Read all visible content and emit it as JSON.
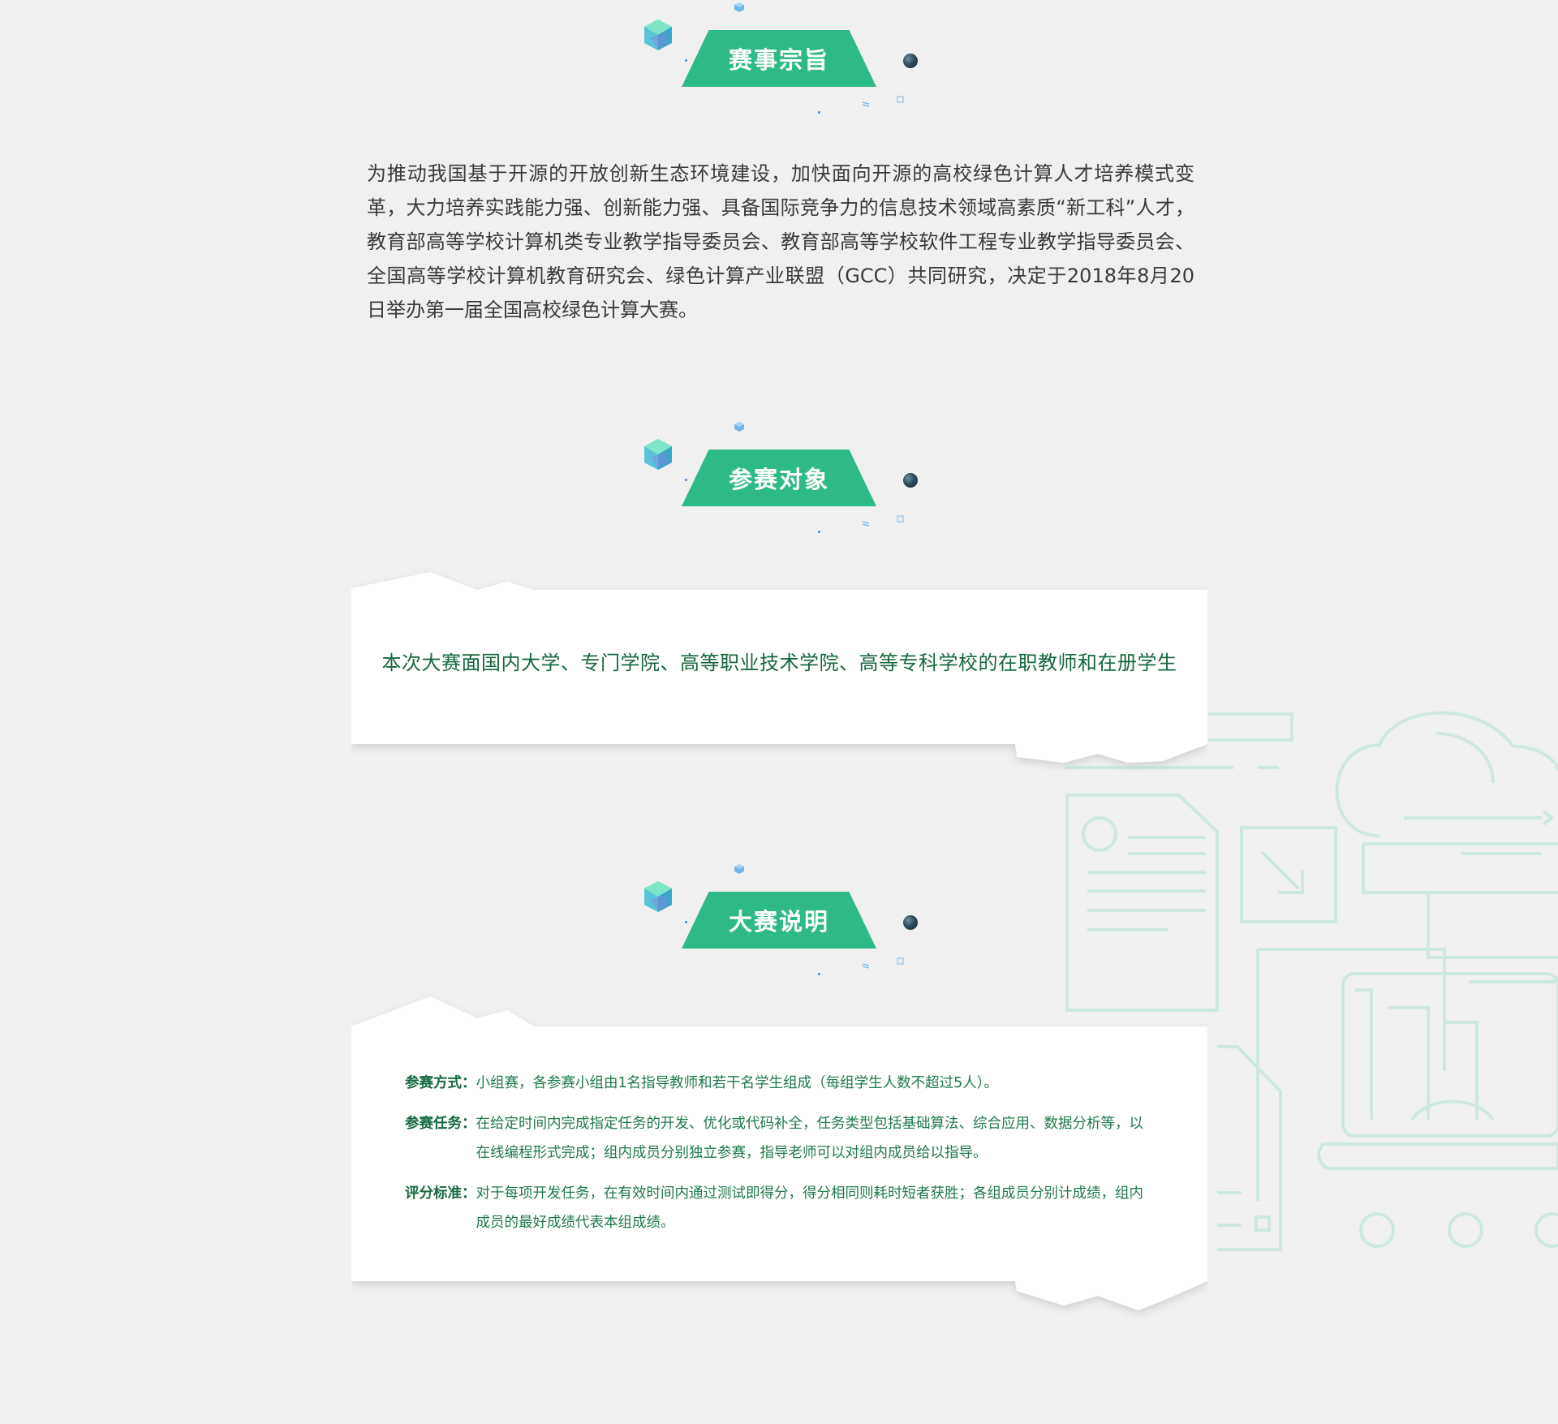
{
  "sections": {
    "purpose": {
      "title": "赛事宗旨",
      "text": "为推动我国基于开源的开放创新生态环境建设，加快面向开源的高校绿色计算人才培养模式变革，大力培养实践能力强、创新能力强、具备国际竞争力的信息技术领域高素质“新工科”人才，教育部高等学校计算机类专业教学指导委员会、教育部高等学校软件工程专业教学指导委员会、全国高等学校计算机教育研究会、绿色计算产业联盟（GCC）共同研究，决定于2018年8月20日举办第一届全国高校绿色计算大赛。"
    },
    "participants": {
      "title": "参赛对象",
      "text": "本次大赛面国内大学、专门学院、高等职业技术学院、高等专科学校的在职教师和在册学生"
    },
    "description": {
      "title": "大赛说明",
      "items": [
        {
          "key": "参赛方式：",
          "value": "小组赛，各参赛小组由1名指导教师和若干名学生组成（每组学生人数不超过5人）。"
        },
        {
          "key": "参赛任务：",
          "value": "在给定时间内完成指定任务的开发、优化或代码补全，任务类型包括基础算法、综合应用、数据分析等，以在线编程形式完成；组内成员分别独立参赛，指导老师可以对组内成员给以指导。"
        },
        {
          "key": "评分标准：",
          "value": "对于每项开发任务，在有效时间内通过测试即得分，得分相同则耗时短者获胜；各组成员分别计成绩，组内成员的最好成绩代表本组成绩。"
        }
      ]
    }
  },
  "colors": {
    "accent": "#2dba86",
    "background": "#f0f0f0",
    "card": "#ffffff",
    "body_text": "#3a3a3a",
    "green_text": "#16683e",
    "line_art": "#cde9df"
  },
  "icons": {
    "gem": "hexagon-gem-icon",
    "orb": "orb-icon",
    "background": "cloud-computing-line-art"
  }
}
